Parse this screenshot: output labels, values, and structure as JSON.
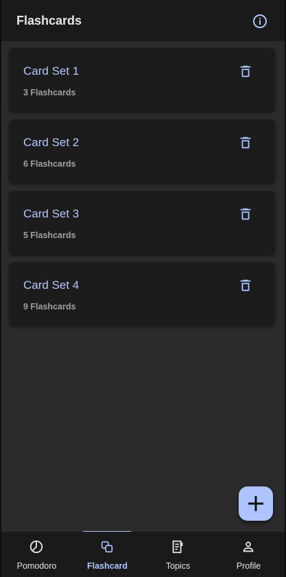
{
  "appbar": {
    "title": "Flashcards",
    "info_icon": "info-icon"
  },
  "sets": [
    {
      "name": "Card Set 1",
      "count": "3 Flashcards"
    },
    {
      "name": "Card Set 2",
      "count": "6 Flashcards"
    },
    {
      "name": "Card Set 3",
      "count": "5 Flashcards"
    },
    {
      "name": "Card Set 4",
      "count": "9 Flashcards"
    }
  ],
  "fab": {
    "icon": "plus-icon"
  },
  "nav": {
    "items": [
      {
        "label": "Pomodoro",
        "icon": "timer-pie-icon"
      },
      {
        "label": "Flashcard",
        "icon": "flashcard-stack-icon",
        "active": true
      },
      {
        "label": "Topics",
        "icon": "topics-document-icon"
      },
      {
        "label": "Profile",
        "icon": "person-icon"
      }
    ]
  },
  "colors": {
    "accent": "#adc4ff",
    "card_title": "#b3c6ff",
    "background": "#2b2b2b",
    "surface": "#1c1c1c"
  }
}
